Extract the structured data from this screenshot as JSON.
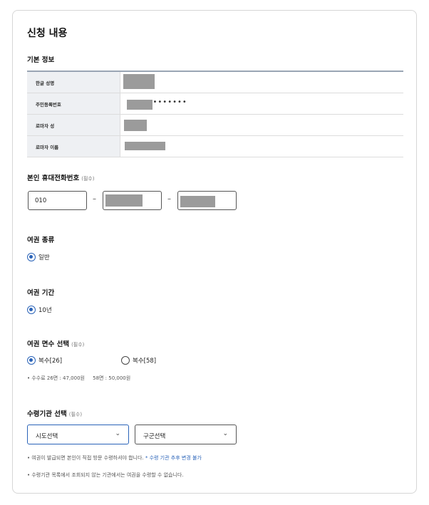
{
  "section_title": "신청 내용",
  "basic_info": {
    "title": "기본 정보",
    "rows": [
      {
        "label": "한글 성명"
      },
      {
        "label": "주민등록번호",
        "masked_suffix": "•••••••"
      },
      {
        "label": "로마자 성"
      },
      {
        "label": "로마자 이름"
      }
    ]
  },
  "phone": {
    "title": "본인 휴대전화번호",
    "required": "(필수)",
    "part1": "010",
    "dash": "–"
  },
  "passport_type": {
    "title": "여권 종류",
    "options": [
      {
        "label": "일반",
        "selected": true
      }
    ]
  },
  "passport_period": {
    "title": "여권 기간",
    "options": [
      {
        "label": "10년",
        "selected": true
      }
    ]
  },
  "page_count": {
    "title": "여권 면수 선택",
    "required": "(필수)",
    "options": [
      {
        "label": "복수[26]",
        "selected": true
      },
      {
        "label": "복수[58]",
        "selected": false
      }
    ],
    "fee_note": "• 수수료 26면 : 47,000원     58면 : 50,000원"
  },
  "office": {
    "title": "수령기관 선택",
    "required": "(필수)",
    "province_select": "시도선택",
    "district_select": "구군선택",
    "note1_text": "• 여권이 발급되면 본인이 직접 방문 수령하셔야 합니다.",
    "note1_link": "* 수령 기관 추후 변경 불가",
    "note2": "• 수령기관 목록에서 조회되지 않는 기관에서는 여권을 수령할 수 없습니다."
  },
  "colors": {
    "accent": "#2a63b8",
    "mask": "#9b9b9b"
  }
}
